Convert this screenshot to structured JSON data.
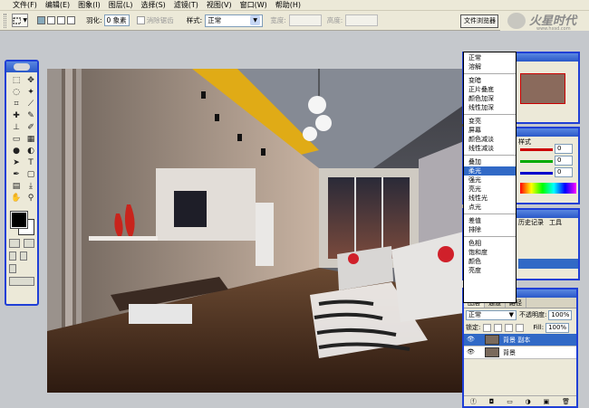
{
  "menu": [
    "文件(F)",
    "编辑(E)",
    "图象(I)",
    "图层(L)",
    "选择(S)",
    "滤镜(T)",
    "视图(V)",
    "窗口(W)",
    "帮助(H)"
  ],
  "options": {
    "feather_label": "羽化:",
    "feather_value": "0 象素",
    "antialias_label": "消除锯齿",
    "style_label": "样式:",
    "style_value": "正常",
    "width_label": "宽度:",
    "height_label": "高度:"
  },
  "browser_button": "文件浏览器",
  "watermark": "火星时代 www.hxsd.com",
  "blend_modes": [
    [
      "正常",
      "溶解"
    ],
    [
      "变暗",
      "正片叠底",
      "颜色加深",
      "线性加深"
    ],
    [
      "变亮",
      "屏幕",
      "颜色减淡",
      "线性减淡"
    ],
    [
      "叠加",
      "柔光",
      "强光",
      "亮光",
      "线性光",
      "点光"
    ],
    [
      "差值",
      "排除"
    ],
    [
      "色相",
      "饱和度",
      "颜色",
      "亮度"
    ]
  ],
  "highlighted_mode": "柔光",
  "layers_panel": {
    "tabs": [
      "图层",
      "通道",
      "路径"
    ],
    "blend_value": "正常",
    "opacity_label": "不透明度:",
    "opacity_value": "100%",
    "lock_label": "锁定:",
    "fill_label": "Fill:",
    "fill_value": "100%",
    "layers": [
      {
        "name": "背景 副本",
        "selected": true
      },
      {
        "name": "背景",
        "selected": false
      }
    ]
  },
  "color_panel": {
    "tab": "样式",
    "values": [
      "0",
      "0",
      "0"
    ]
  },
  "history_tabs": [
    "历史记录",
    "工具"
  ],
  "colors": {
    "title_blue": "#2a58c8",
    "highlight": "#3169c6"
  }
}
